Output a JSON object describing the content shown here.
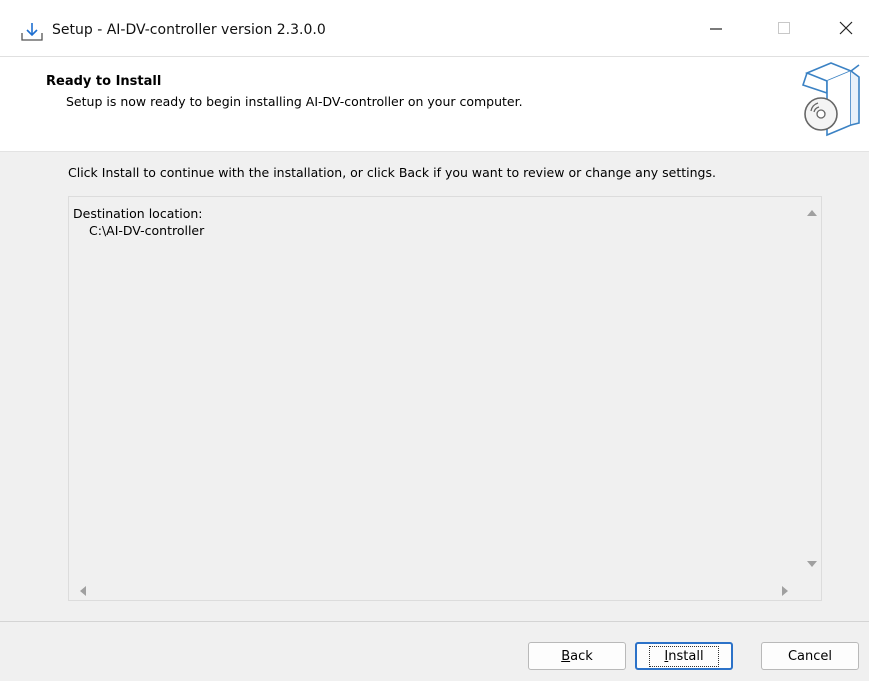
{
  "window": {
    "title": "Setup - AI-DV-controller version 2.3.0.0",
    "controls": [
      "minimize-icon",
      "maximize-icon",
      "close-icon"
    ]
  },
  "header": {
    "heading": "Ready to Install",
    "subheading": "Setup is now ready to begin installing AI-DV-controller on your computer.",
    "icon": "install-box-icon"
  },
  "content": {
    "instruction": "Click Install to continue with the installation, or click Back if you want to review or change any settings.",
    "memo": {
      "label": "Destination location:",
      "value": "C:\\AI-DV-controller"
    }
  },
  "buttons": {
    "back": {
      "mnemonic": "B",
      "rest": "ack"
    },
    "install": {
      "mnemonic": "I",
      "rest": "nstall"
    },
    "cancel": "Cancel"
  },
  "colors": {
    "accent": "#2c72c8",
    "content_bg": "#f0f0f0"
  }
}
